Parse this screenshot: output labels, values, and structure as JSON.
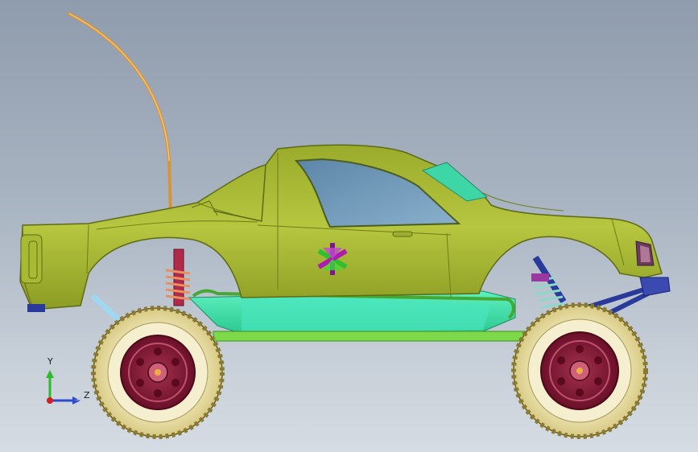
{
  "triad": {
    "y_label": "Y",
    "z_label": "Z"
  },
  "colors": {
    "background_top": "#8f9cad",
    "background_bottom": "#d6dce3",
    "body": "#b5c73e",
    "body_dark": "#7f8f1e",
    "window": "#6f9ab8",
    "chassis": "#3fe0a8",
    "tire": "#efe4a6",
    "rim": "#8a1e3a",
    "spring": "#8fd7c8",
    "antenna": "#e0a040",
    "arm": "#2a3a9a",
    "axis_y": "#2eb82e",
    "axis_z": "#2a4ad0",
    "axis_x": "#d02020"
  },
  "icons": {
    "logo": "asterisk-logo-icon"
  }
}
